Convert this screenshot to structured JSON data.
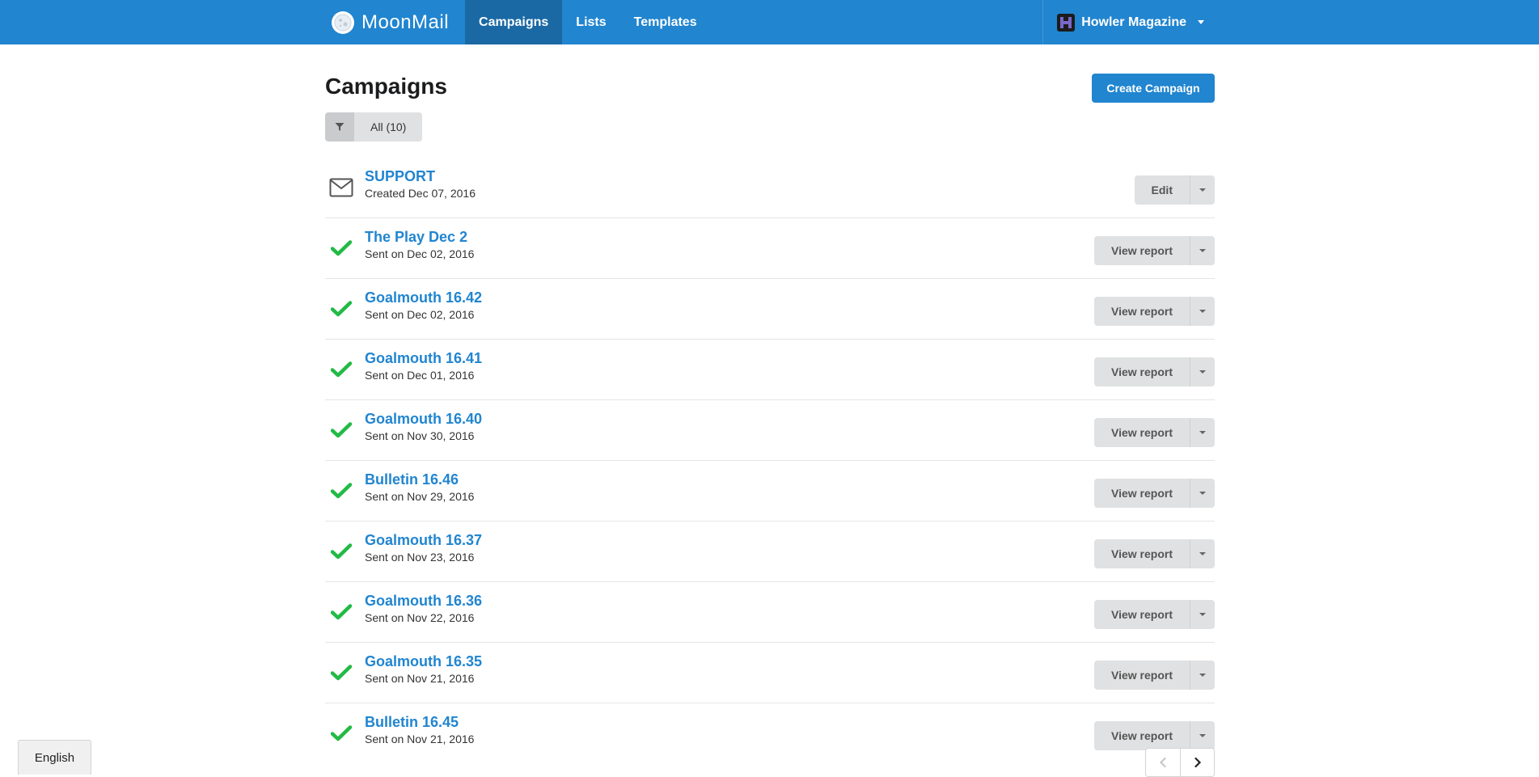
{
  "brand": {
    "name": "MoonMail",
    "logo_icon": "moon-logo-icon"
  },
  "nav": {
    "items": [
      {
        "label": "Campaigns",
        "active": true
      },
      {
        "label": "Lists",
        "active": false
      },
      {
        "label": "Templates",
        "active": false
      }
    ]
  },
  "account": {
    "name": "Howler Magazine",
    "avatar_icon": "account-avatar-icon"
  },
  "page": {
    "title": "Campaigns",
    "create_label": "Create Campaign"
  },
  "filter": {
    "icon": "filter-icon",
    "label": "All (10)"
  },
  "campaigns": [
    {
      "title": "SUPPORT",
      "subtitle": "Created Dec 07, 2016",
      "status": "draft",
      "icon": "envelope-icon",
      "action": "Edit"
    },
    {
      "title": "The Play Dec 2",
      "subtitle": "Sent on Dec 02, 2016",
      "status": "sent",
      "icon": "checkmark-icon",
      "action": "View report"
    },
    {
      "title": "Goalmouth 16.42",
      "subtitle": "Sent on Dec 02, 2016",
      "status": "sent",
      "icon": "checkmark-icon",
      "action": "View report"
    },
    {
      "title": "Goalmouth 16.41",
      "subtitle": "Sent on Dec 01, 2016",
      "status": "sent",
      "icon": "checkmark-icon",
      "action": "View report"
    },
    {
      "title": "Goalmouth 16.40",
      "subtitle": "Sent on Nov 30, 2016",
      "status": "sent",
      "icon": "checkmark-icon",
      "action": "View report"
    },
    {
      "title": "Bulletin 16.46",
      "subtitle": "Sent on Nov 29, 2016",
      "status": "sent",
      "icon": "checkmark-icon",
      "action": "View report"
    },
    {
      "title": "Goalmouth 16.37",
      "subtitle": "Sent on Nov 23, 2016",
      "status": "sent",
      "icon": "checkmark-icon",
      "action": "View report"
    },
    {
      "title": "Goalmouth 16.36",
      "subtitle": "Sent on Nov 22, 2016",
      "status": "sent",
      "icon": "checkmark-icon",
      "action": "View report"
    },
    {
      "title": "Goalmouth 16.35",
      "subtitle": "Sent on Nov 21, 2016",
      "status": "sent",
      "icon": "checkmark-icon",
      "action": "View report"
    },
    {
      "title": "Bulletin 16.45",
      "subtitle": "Sent on Nov 21, 2016",
      "status": "sent",
      "icon": "checkmark-icon",
      "action": "View report"
    }
  ],
  "pagination": {
    "prev_icon": "chevron-left-icon",
    "next_icon": "chevron-right-icon"
  },
  "language": {
    "label": "English"
  },
  "colors": {
    "primary": "#2185d0",
    "nav_active": "#1a69a4",
    "success": "#21ba45",
    "button_gray": "#e0e1e2"
  }
}
